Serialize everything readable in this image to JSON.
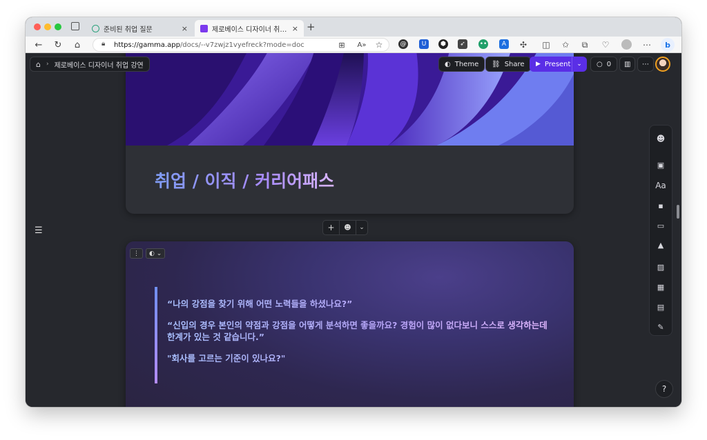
{
  "browser": {
    "tabs": [
      {
        "label": "준비된 취업 질문",
        "close": "×"
      },
      {
        "label": "제로베이스 디자이너 취업 강연 | Ga",
        "close": "×"
      }
    ],
    "new_tab": "+",
    "url": "https://gamma.app/docs/--v7zwjz1vyefreck?mode=doc",
    "url_host": "https://gamma.app",
    "url_path": "/docs/--v7zwjz1vyefreck?mode=doc",
    "colors": {
      "close": "#ff5f57",
      "minimize": "#febc2e",
      "maximize": "#28c840"
    }
  },
  "doc": {
    "breadcrumb": "제로베이스 디자이너 취업 강연",
    "theme_label": "Theme",
    "share_label": "Share",
    "present_label": "Present",
    "comments_count": "0",
    "card1_title": "취업 / 이직 / 커리어패스",
    "quotes": [
      "“나의 강점을 찾기 위해 어떤 노력들을 하셨나요?”",
      "“신입의 경우 본인의 약점과 강점을 어떻게 분석하면 좋을까요? 경험이 많이 없다보니 스스로 생각하는데 한계가 있는 것 같습니다.”",
      "\"회사를 고르는 기준이 있나요?\""
    ],
    "help_label": "?",
    "colors": {
      "accent": "#5a2ee6",
      "background": "#26282d"
    }
  }
}
